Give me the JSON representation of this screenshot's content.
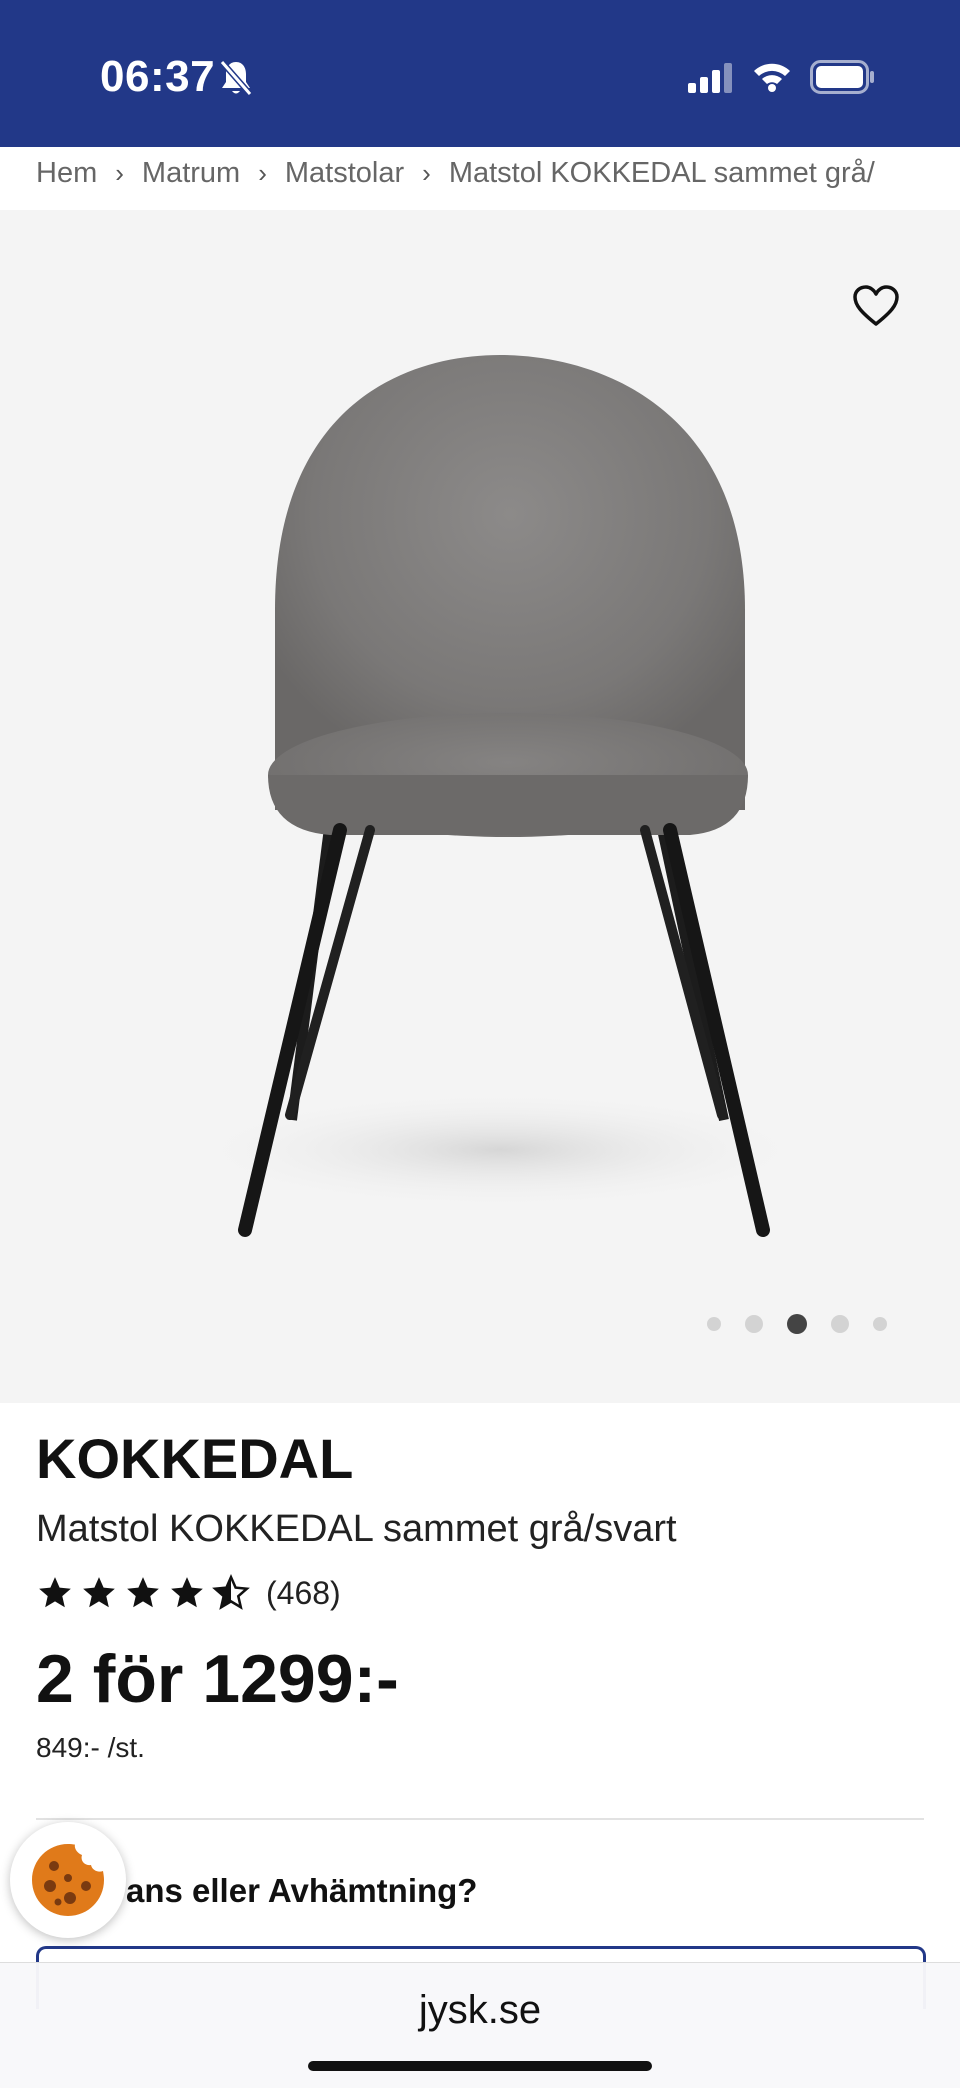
{
  "status_bar": {
    "time": "06:37",
    "icons": [
      "bell-slash-icon",
      "signal-icon",
      "wifi-icon",
      "battery-icon"
    ],
    "background": "#223888"
  },
  "breadcrumb": {
    "items": [
      "Hem",
      "Matrum",
      "Matstolar",
      "Matstol KOKKEDAL sammet grå/"
    ]
  },
  "gallery": {
    "image_subject": "gray velvet dining chair with black legs",
    "favorite_icon": "heart-icon",
    "dots_count": 5,
    "active_dot": 3
  },
  "product": {
    "brand": "KOKKEDAL",
    "name": "Matstol KOKKEDAL sammet grå/svart",
    "rating_stars": 4.5,
    "rating_count": "(468)",
    "price": "2 för 1299:-",
    "unit_price": "849:- /st."
  },
  "delivery": {
    "question": "ans eller Avhämtning?"
  },
  "cookie": {
    "icon": "cookie-icon"
  },
  "browser": {
    "url": "jysk.se"
  },
  "colors": {
    "brand_blue": "#223888",
    "gallery_bg": "#f4f4f4"
  }
}
